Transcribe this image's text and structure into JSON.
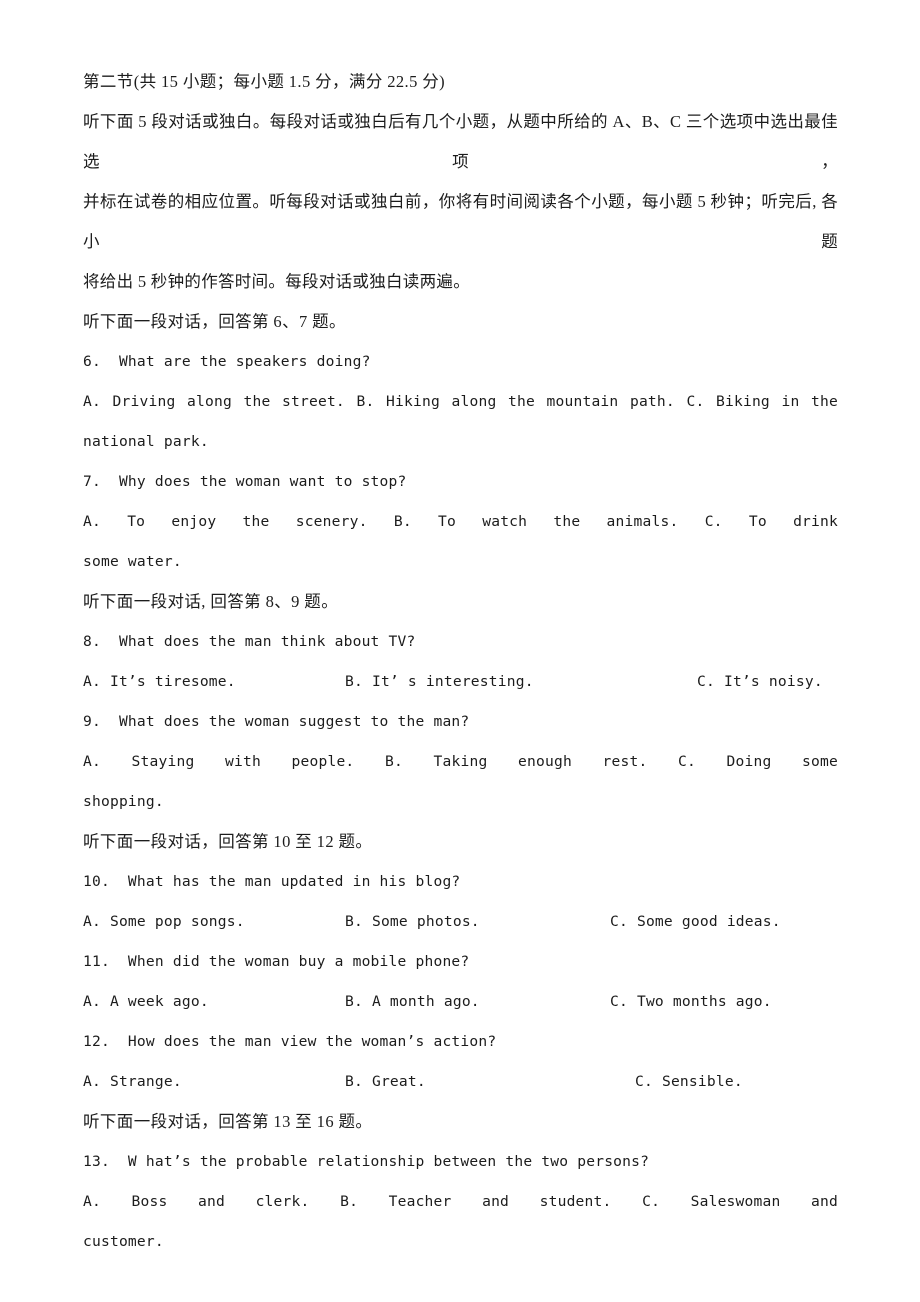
{
  "document": {
    "section_heading": "第二节(共 15 小题；每小题 1.5 分，满分 22.5 分)",
    "directions": [
      "听下面 5 段对话或独白。每段对话或独白后有几个小题，从题中所给的 A、B、C 三个选项中选出最佳选项，",
      "并标在试卷的相应位置。听每段对话或独白前，你将有时间阅读各个小题，每小题 5 秒钟；听完后, 各小题",
      "将给出 5 秒钟的作答时间。每段对话或独白读两遍。"
    ],
    "groups": [
      {
        "lead_in": "听下面一段对话，回答第 6、7 题。",
        "questions": [
          {
            "number": "6.",
            "stem": "6.  What are the speakers doing?",
            "layout": "justified",
            "options": [
              "A. Driving along the street.",
              "B. Hiking along the mountain path.",
              "C.  Biking  in  the"
            ],
            "wrap": "national park."
          },
          {
            "number": "7.",
            "stem": "7.  Why does the woman want to stop?",
            "layout": "justified",
            "options": [
              "A. To enjoy the scenery.",
              "B. To watch the animals.",
              "C.  To  drink"
            ],
            "wrap": "some water."
          }
        ]
      },
      {
        "lead_in": "听下面一段对话, 回答第 8、9 题。",
        "questions": [
          {
            "number": "8.",
            "stem": "8.  What does the man think about TV?",
            "layout": "columns",
            "options": [
              "A. It’s tiresome.",
              "B. It’ s interesting.",
              "C. It’s noisy."
            ],
            "wrap": ""
          },
          {
            "number": "9.",
            "stem": "9.  What does the woman suggest to the man?",
            "layout": "justified",
            "options": [
              "A. Staying with people.",
              "B. Taking enough rest.",
              "C.    Doing    some"
            ],
            "wrap": "shopping."
          }
        ]
      },
      {
        "lead_in": "听下面一段对话，回答第 10 至 12 题。",
        "questions": [
          {
            "number": "10.",
            "stem": "10.  What has the man updated in his blog?",
            "layout": "columns",
            "options": [
              "A. Some pop songs.",
              "B. Some photos.",
              "C. Some good ideas."
            ],
            "wrap": ""
          },
          {
            "number": "11.",
            "stem": "11.  When did the woman buy a mobile phone?",
            "layout": "columns",
            "options": [
              "A. A week ago.",
              "B. A month ago.",
              "C. Two months ago."
            ],
            "wrap": ""
          },
          {
            "number": "12.",
            "stem": "12.  How does the man view the woman’s action?",
            "layout": "columns",
            "options": [
              "A. Strange.",
              "B. Great.",
              "C. Sensible."
            ],
            "wrap": ""
          }
        ]
      },
      {
        "lead_in": "听下面一段对话，回答第 13 至 16 题。",
        "questions": [
          {
            "number": "13.",
            "stem": "13.  W hat’s the probable relationship between the two persons?",
            "layout": "justified",
            "options": [
              "A. Boss and clerk.",
              "B. Teacher and student.",
              "C.   Saleswoman   and"
            ],
            "wrap": "customer."
          }
        ]
      }
    ]
  }
}
